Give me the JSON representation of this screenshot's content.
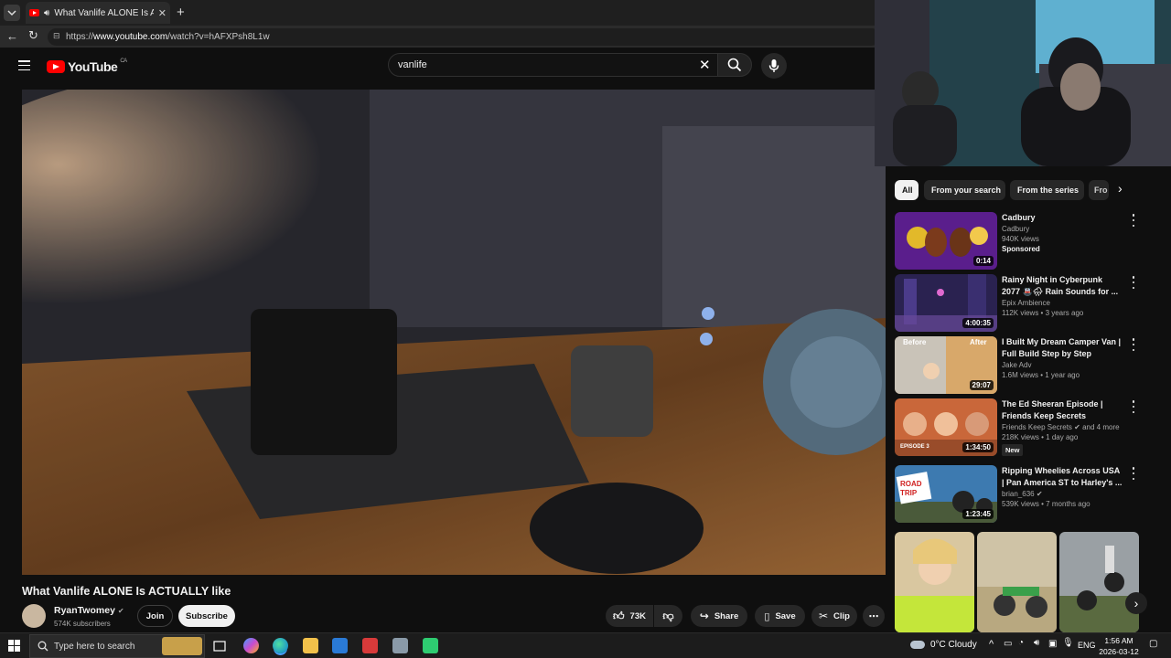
{
  "browser": {
    "tab_title": "What Vanlife ALONE Is ACTUA",
    "url_prefix": "https://",
    "url_host": "www.youtube.com",
    "url_path": "/watch?v=hAFXPsh8L1w"
  },
  "youtube": {
    "logo_text": "YouTube",
    "region": "CA",
    "search_value": "vanlife"
  },
  "video": {
    "title": "What Vanlife ALONE Is ACTUALLY like",
    "channel": "RyanTwomey",
    "subscribers": "574K subscribers",
    "join_label": "Join",
    "subscribe_label": "Subscribe",
    "likes": "73K",
    "share_label": "Share",
    "save_label": "Save",
    "clip_label": "Clip"
  },
  "chips": [
    "All",
    "From your search",
    "From the series",
    "Fro"
  ],
  "recommendations": [
    {
      "title": "Cadbury",
      "channel": "Cadbury",
      "line2": "940K views",
      "line3": "Sponsored",
      "duration": "0:14",
      "thumb_color": "#5a1e8c"
    },
    {
      "title": "Rainy Night in Cyberpunk 2077 🚇🌧 Rain Sounds for ...",
      "channel": "Epix Ambience",
      "line2": "112K views • 3 years ago",
      "duration": "4:00:35",
      "thumb_color": "#2a2250"
    },
    {
      "title": "I Built My Dream Camper Van | Full Build Step by Step",
      "channel": "Jake Adv",
      "line2": "1.6M views • 1 year ago",
      "duration": "29:07",
      "thumb_color": "#b48a5a",
      "overlay_left": "Before",
      "overlay_right": "After"
    },
    {
      "title": "The Ed Sheeran Episode | Friends Keep Secrets",
      "channel": "Friends Keep Secrets",
      "channel_extra": "and 4 more",
      "line2": "218K views • 1 day ago",
      "badge": "New",
      "duration": "1:34:50",
      "thumb_color": "#c9673a",
      "overlay_left": "EPISODE 3"
    },
    {
      "title": "Ripping Wheelies Across USA | Pan America ST to Harley's ...",
      "channel": "brian_636",
      "line2": "539K views • 7 months ago",
      "duration": "1:23:45",
      "thumb_color": "#3d7ab0",
      "overlay_left": "ROAD TRIP"
    }
  ],
  "taskbar": {
    "search_placeholder": "Type here to search",
    "weather": "0°C  Cloudy",
    "lang": "ENG",
    "time": "1:56 AM",
    "date": "2026-03-12"
  },
  "colors": {
    "youtube_red": "#ff0000",
    "background": "#0f0f0f",
    "chip_active": "#f1f1f1"
  }
}
